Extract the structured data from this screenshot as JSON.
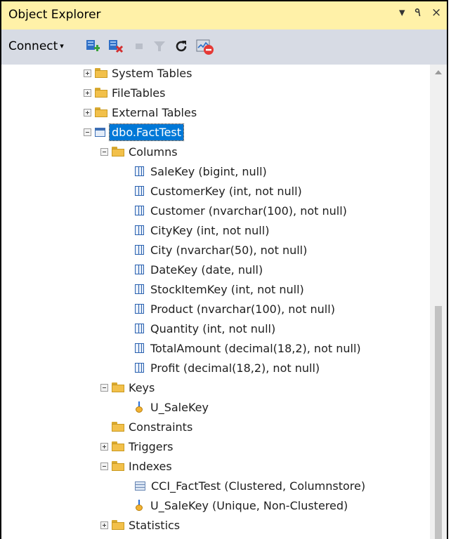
{
  "window": {
    "title": "Object Explorer",
    "pin_glyph": "↓ ٩",
    "dropdown_glyph": "▾",
    "pushpin_glyph": "٩",
    "close_glyph": "×"
  },
  "toolbar": {
    "connect_label": "Connect",
    "connect_caret": "▾"
  },
  "tree": {
    "system_tables": "System Tables",
    "file_tables": "FileTables",
    "external_tables": "External Tables",
    "table_name": "dbo.FactTest",
    "columns_folder": "Columns",
    "columns": [
      "SaleKey (bigint, null)",
      "CustomerKey (int, not null)",
      "Customer (nvarchar(100), not null)",
      "CityKey (int, not null)",
      "City (nvarchar(50), not null)",
      "DateKey (date, null)",
      "StockItemKey (int, not null)",
      "Product (nvarchar(100), not null)",
      "Quantity (int, not null)",
      "TotalAmount (decimal(18,2), not null)",
      "Profit (decimal(18,2), not null)"
    ],
    "keys_folder": "Keys",
    "key_item": "U_SaleKey",
    "constraints_folder": "Constraints",
    "triggers_folder": "Triggers",
    "indexes_folder": "Indexes",
    "indexes": [
      "CCI_FactTest (Clustered, Columnstore)",
      "U_SaleKey (Unique, Non-Clustered)"
    ],
    "statistics_folder": "Statistics"
  }
}
